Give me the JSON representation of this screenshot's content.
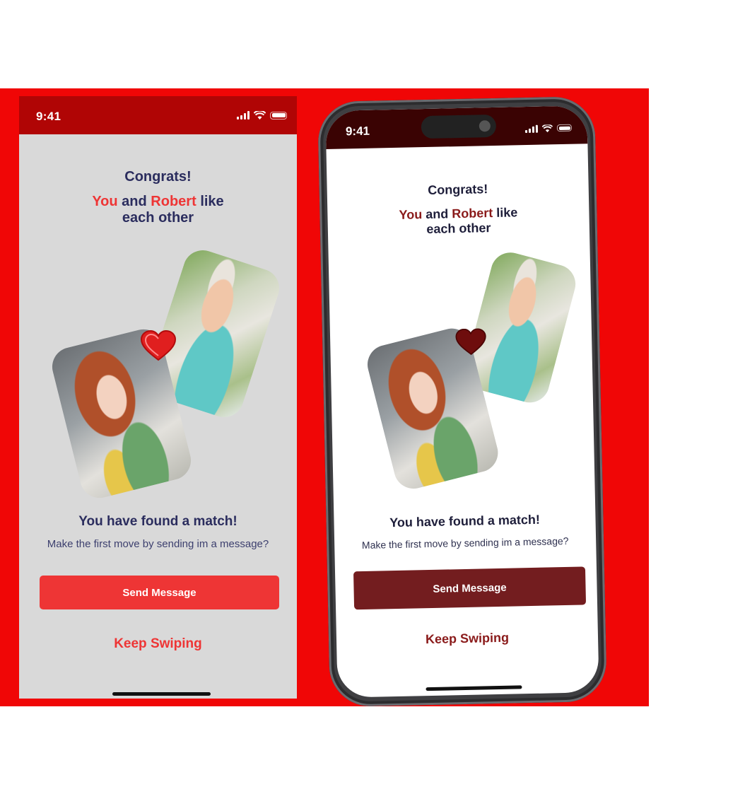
{
  "colors": {
    "background_red": "#f00606",
    "flat_status_bar": "#b00505",
    "flat_screen_bg": "#d9d9d9",
    "flat_accent": "#ee3535",
    "phone_status_bar": "#3a0303",
    "phone_accent": "#8a1a1a",
    "phone_button": "#731d1f",
    "text_navy": "#2b2d5e"
  },
  "flat": {
    "status": {
      "time": "9:41",
      "icons": [
        "cellular-signal-icon",
        "wifi-icon",
        "battery-icon"
      ]
    },
    "congrats": "Congrats!",
    "you": "You",
    "and": "and",
    "name": "Robert",
    "like": "like",
    "each_other": "each other",
    "photos": {
      "man": "robert-photo",
      "woman": "user-photo",
      "heart": "heart-icon"
    },
    "found_title": "You have found a match!",
    "found_sub": "Make the first move by sending im a message?",
    "send_label": "Send Message",
    "keep_label": "Keep Swiping"
  },
  "phone": {
    "status": {
      "time": "9:41",
      "icons": [
        "cellular-signal-icon",
        "wifi-icon",
        "battery-icon"
      ]
    },
    "congrats": "Congrats!",
    "you": "You",
    "and": "and",
    "name": "Robert",
    "like": "like",
    "each_other": "each other",
    "found_title": "You have found a match!",
    "found_sub": "Make the first move by sending im a message?",
    "send_label": "Send Message",
    "keep_label": "Keep Swiping"
  }
}
